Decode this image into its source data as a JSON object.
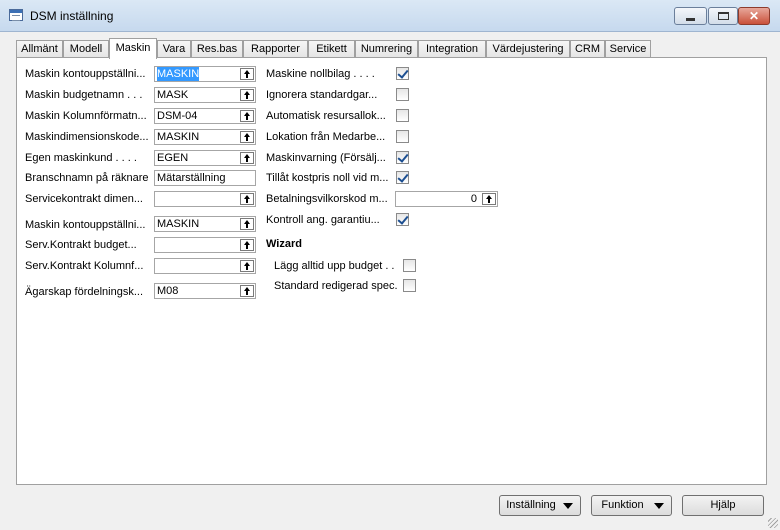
{
  "window": {
    "title": "DSM inställning"
  },
  "tabs": [
    {
      "label": "Allmänt"
    },
    {
      "label": "Modell"
    },
    {
      "label": "Maskin"
    },
    {
      "label": "Vara"
    },
    {
      "label": "Res.bas"
    },
    {
      "label": "Rapporter"
    },
    {
      "label": "Etikett"
    },
    {
      "label": "Numrering"
    },
    {
      "label": "Integration"
    },
    {
      "label": "Värdejustering"
    },
    {
      "label": "CRM"
    },
    {
      "label": "Service"
    }
  ],
  "left_fields": [
    {
      "label": "Maskin kontouppställni...",
      "value": "MASKIN"
    },
    {
      "label": "Maskin budgetnamn  .  .  .",
      "value": "MASK"
    },
    {
      "label": "Maskin Kolumnförmatn...",
      "value": "DSM-04"
    },
    {
      "label": "Maskindimensionskode...",
      "value": "MASKIN"
    },
    {
      "label": "Egen maskinkund  .  .  .  .",
      "value": "EGEN"
    },
    {
      "label": "Branschnamn på räknare",
      "value": "Mätarställning"
    },
    {
      "label": "Servicekontrakt dimen...",
      "value": ""
    },
    {
      "label": "Maskin kontouppställni...",
      "value": "MASKIN"
    },
    {
      "label": "Serv.Kontrakt budget...",
      "value": ""
    },
    {
      "label": "Serv.Kontrakt Kolumnf...",
      "value": ""
    },
    {
      "label": "Ägarskap fördelningsk...",
      "value": "M08"
    }
  ],
  "right_fields": [
    {
      "label": "Maskine nollbilag  .  .  .  .",
      "checked": true
    },
    {
      "label": "Ignorera  standardgar...",
      "checked": false
    },
    {
      "label": "Automatisk resursallok...",
      "checked": false
    },
    {
      "label": "Lokation från Medarbe...",
      "checked": false
    },
    {
      "label": "Maskinvarning (Försälj...",
      "checked": true
    },
    {
      "label": "Tillåt kostpris noll vid m...",
      "checked": true
    },
    {
      "label": "Betalningsvilkorskod m...",
      "value": "0"
    },
    {
      "label": "Kontroll ang. garantiu...",
      "checked": true
    }
  ],
  "wizard": {
    "heading": "Wizard",
    "items": [
      {
        "label": "Lägg alltid upp budget  .  .",
        "checked": false
      },
      {
        "label": "Standard redigerad spec.",
        "checked": false
      }
    ]
  },
  "buttons": {
    "setup": "Inställning",
    "function": "Funktion",
    "help": "Hjälp"
  }
}
